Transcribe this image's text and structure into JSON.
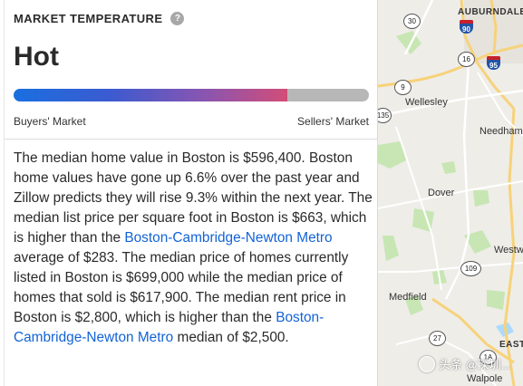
{
  "market": {
    "title": "MARKET TEMPERATURE",
    "help_icon": "?",
    "temperature": "Hot",
    "level_percent": 77,
    "left_label": "Buyers' Market",
    "right_label": "Sellers' Market"
  },
  "description": {
    "p1": "The median home value in Boston is $596,400. Boston home values have gone up 6.6% over the past year and Zillow predicts they will rise 9.3% within the next year. The median list price per square foot in Boston is $663, which is higher than the ",
    "link1": "Boston-Cambridge-Newton Metro",
    "p2": " average of $283. The median price of homes currently listed in Boston is $699,000 while the median price of homes that sold is $617,900. The median rent price in Boston is $2,800, which is higher than the ",
    "link2": "Boston-Cambridge-Newton Metro",
    "p3": " median of $2,500."
  },
  "map": {
    "labels": {
      "auburndale": "AUBURNDALE",
      "wellesley": "Wellesley",
      "needham": "Needham",
      "dover": "Dover",
      "westwood": "Westw",
      "medfield": "Medfield",
      "east": "EAST",
      "walpole": "Walpole"
    },
    "shields": {
      "r30": "30",
      "r16": "16",
      "r9": "9",
      "r135": "135",
      "r109": "109",
      "r27": "27",
      "r1a": "1A",
      "i90": "90",
      "i95": "95"
    }
  },
  "watermark": "头条 @深圳..."
}
